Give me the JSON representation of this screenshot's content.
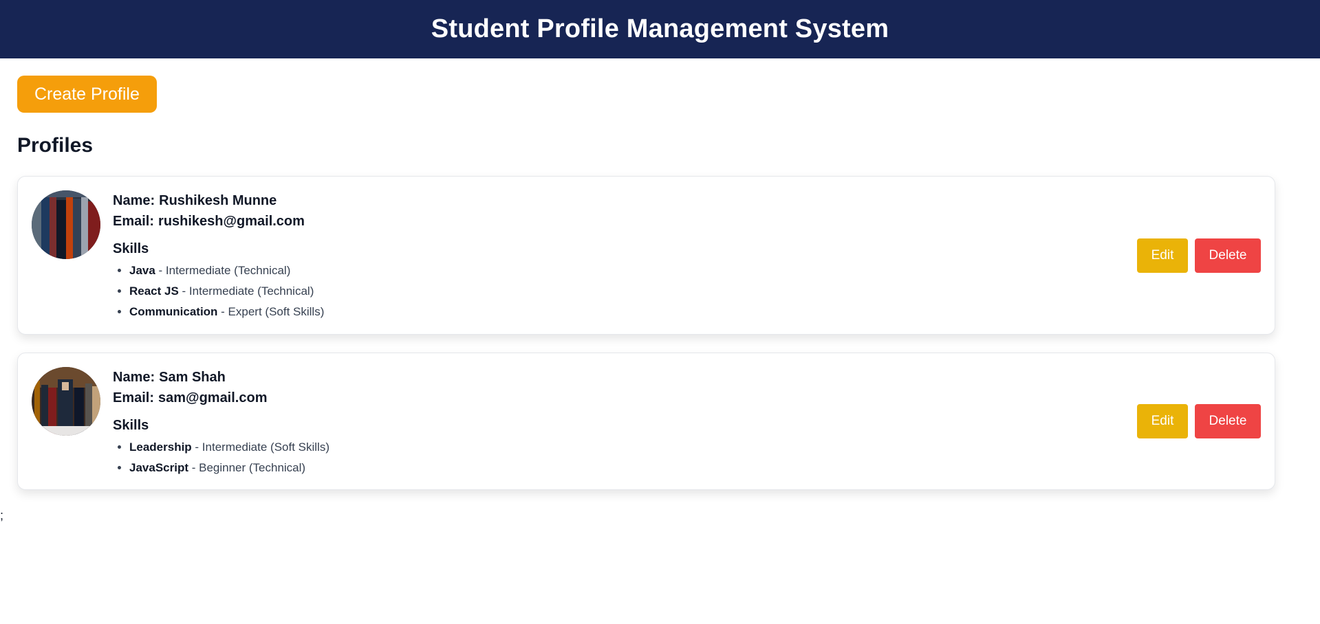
{
  "header": {
    "title": "Student Profile Management System"
  },
  "toolbar": {
    "create_label": "Create Profile"
  },
  "profiles_section": {
    "title": "Profiles"
  },
  "labels": {
    "name": "Name:",
    "email": "Email:",
    "skills": "Skills",
    "edit": "Edit",
    "delete": "Delete"
  },
  "profiles": [
    {
      "name": "Rushikesh Munne",
      "email": "rushikesh@gmail.com",
      "skills": [
        {
          "name": "Java",
          "detail": " - Intermediate (Technical)"
        },
        {
          "name": "React JS",
          "detail": " - Intermediate (Technical)"
        },
        {
          "name": "Communication",
          "detail": " - Expert (Soft Skills)"
        }
      ]
    },
    {
      "name": "Sam Shah",
      "email": "sam@gmail.com",
      "skills": [
        {
          "name": "Leadership",
          "detail": " - Intermediate (Soft Skills)"
        },
        {
          "name": "JavaScript",
          "detail": " - Beginner (Technical)"
        }
      ]
    }
  ],
  "stray_text": ";",
  "colors": {
    "header_bg": "#172554",
    "create_button": "#f59e0b",
    "edit_button": "#eab308",
    "delete_button": "#ef4444"
  }
}
